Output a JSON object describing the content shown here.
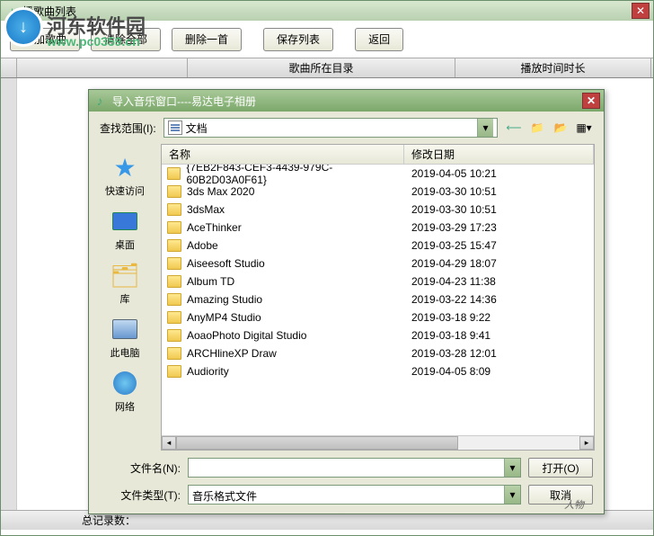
{
  "main": {
    "title": "播歌曲列表",
    "toolbar": {
      "add": "添加歌曲",
      "clear": "清除全部",
      "delete": "删除一首",
      "save": "保存列表",
      "back": "返回"
    },
    "columns": {
      "c2": "",
      "c3": "歌曲所在目录",
      "c4": "播放时间时长"
    },
    "status_label": "总记录数："
  },
  "watermark": {
    "brand": "河东软件园",
    "url": "www.pc0359.cn"
  },
  "dialog": {
    "title": "导入音乐窗口----易达电子相册",
    "lookin_label": "查找范围(I):",
    "lookin_value": "文档",
    "columns": {
      "name": "名称",
      "date": "修改日期"
    },
    "sidebar": [
      {
        "label": "快速访问"
      },
      {
        "label": "桌面"
      },
      {
        "label": "库"
      },
      {
        "label": "此电脑"
      },
      {
        "label": "网络"
      }
    ],
    "files": [
      {
        "name": "{7EB2F843-CEF3-4439-979C-60B2D03A0F61}",
        "date": "2019-04-05 10:21"
      },
      {
        "name": "3ds Max 2020",
        "date": "2019-03-30 10:51"
      },
      {
        "name": "3dsMax",
        "date": "2019-03-30 10:51"
      },
      {
        "name": "AceThinker",
        "date": "2019-03-29 17:23"
      },
      {
        "name": "Adobe",
        "date": "2019-03-25 15:47"
      },
      {
        "name": "Aiseesoft Studio",
        "date": "2019-04-29 18:07"
      },
      {
        "name": "Album TD",
        "date": "2019-04-23 11:38"
      },
      {
        "name": "Amazing Studio",
        "date": "2019-03-22 14:36"
      },
      {
        "name": "AnyMP4 Studio",
        "date": "2019-03-18 9:22"
      },
      {
        "name": "AoaoPhoto Digital Studio",
        "date": "2019-03-18 9:41"
      },
      {
        "name": "ARCHlineXP Draw",
        "date": "2019-03-28 12:01"
      },
      {
        "name": "Audiority",
        "date": "2019-04-05 8:09"
      }
    ],
    "filename_label": "文件名(N):",
    "filename_value": "",
    "filetype_label": "文件类型(T):",
    "filetype_value": "音乐格式文件",
    "open_btn": "打开(O)",
    "cancel_btn": "取消",
    "signature": "人物"
  }
}
